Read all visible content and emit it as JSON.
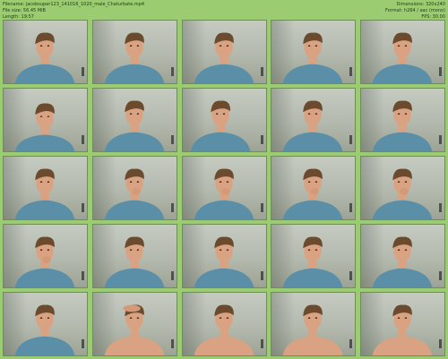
{
  "header": {
    "filename_line": "Filename: jacobsuper123_141016_1020_male_Chaturbate.mp4",
    "filesize_line": "File size: 56.45 MiB",
    "length_line": "Length: 19:57",
    "dimensions_line": "Dimensions: 320x240",
    "format_line": "Format: h264 / aac (mono)",
    "fps_line": "FPS: 30.00"
  },
  "colors": {
    "sheet_background": "#9ccc72",
    "shirt_blue": "#5b8fa8",
    "skin": "#d9a383",
    "hair": "#6b4a2e"
  },
  "thumbnails": [
    {
      "pose": "shirt-center"
    },
    {
      "pose": "shirt-center"
    },
    {
      "pose": "shirt-center"
    },
    {
      "pose": "shirt-center"
    },
    {
      "pose": "shirt-center"
    },
    {
      "pose": "shirt-lower"
    },
    {
      "pose": "shirt-center"
    },
    {
      "pose": "shirt-left"
    },
    {
      "pose": "shirt-center"
    },
    {
      "pose": "shirt-center"
    },
    {
      "pose": "shirt-center"
    },
    {
      "pose": "shirt-hand"
    },
    {
      "pose": "shirt-hand"
    },
    {
      "pose": "shirt-hand"
    },
    {
      "pose": "shirt-hand"
    },
    {
      "pose": "shirt-hand"
    },
    {
      "pose": "shirt-center"
    },
    {
      "pose": "shirt-center"
    },
    {
      "pose": "shirt-center"
    },
    {
      "pose": "shirt-center"
    },
    {
      "pose": "shirt-center"
    },
    {
      "pose": "bare-hand-head"
    },
    {
      "pose": "bare-center"
    },
    {
      "pose": "bare-center"
    },
    {
      "pose": "bare-center"
    }
  ]
}
